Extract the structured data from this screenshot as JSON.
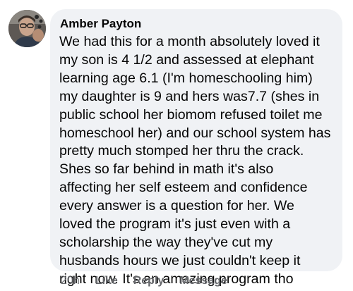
{
  "comment": {
    "author": "Amber Payton",
    "text": "We had this for a month absolutely loved it\nmy son is 4 1/2 and assessed at elephant\nlearning age 6.1 (I'm homeschooling him)\nmy daughter is 9 and hers was7.7 (shes in\npublic school her biomom refused toilet me\nhomeschool her) and our school system has\npretty much stomped her thru the crack.\nShes so far behind in math it's also\naffecting her self esteem and confidence\nevery answer is a question for her.  We\nloved the program it's just even with a\nscholarship the way they've cut my\nhusbands hours we just couldn't keep it\nright now.  It's an amazing program tho",
    "timestamp": "20h",
    "actions": {
      "like": "Like",
      "reply": "Reply",
      "message": "Message"
    }
  },
  "colors": {
    "bubble_background": "#f0f2f5",
    "text": "#050505",
    "secondary_text": "#65676b"
  },
  "icons": {
    "avatar": "profile-photo"
  }
}
